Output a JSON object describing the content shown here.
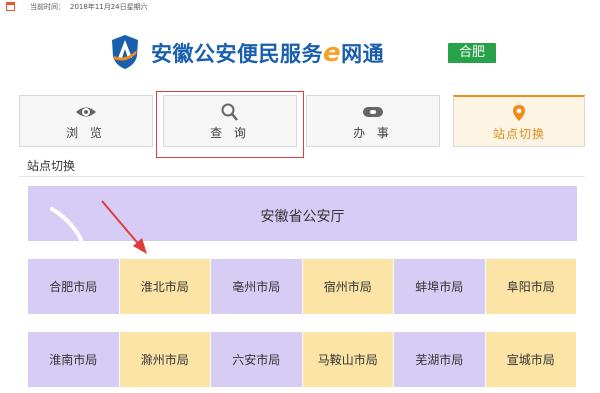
{
  "topbar": {
    "date_label": "当前时间：",
    "date_value": "2018年11月24日星期六"
  },
  "header": {
    "brand_prefix": "安徽公安便民服务",
    "brand_e": "e",
    "brand_suffix": "网通",
    "city": "合肥"
  },
  "tabs": [
    {
      "label": "浏 览",
      "icon": "eye-icon"
    },
    {
      "label": "查 询",
      "icon": "search-icon"
    },
    {
      "label": "办 事",
      "icon": "handshake-icon"
    },
    {
      "label": "站点切换",
      "icon": "location-pin-icon",
      "active": true
    }
  ],
  "section_title": "站点切换",
  "province": "安徽省公安厅",
  "cities_row1": [
    "合肥市局",
    "淮北市局",
    "亳州市局",
    "宿州市局",
    "蚌埠市局",
    "阜阳市局"
  ],
  "cities_row2": [
    "淮南市局",
    "滁州市局",
    "六安市局",
    "马鞍山市局",
    "芜湖市局",
    "宣城市局"
  ],
  "colors": {
    "brand_blue": "#1a5fad",
    "accent_orange": "#f18c1a",
    "badge_green": "#27a14a",
    "purple_cell": "#d7ccf3",
    "yellow_cell": "#fbe4a5",
    "annotation_red": "#e03c3c"
  }
}
